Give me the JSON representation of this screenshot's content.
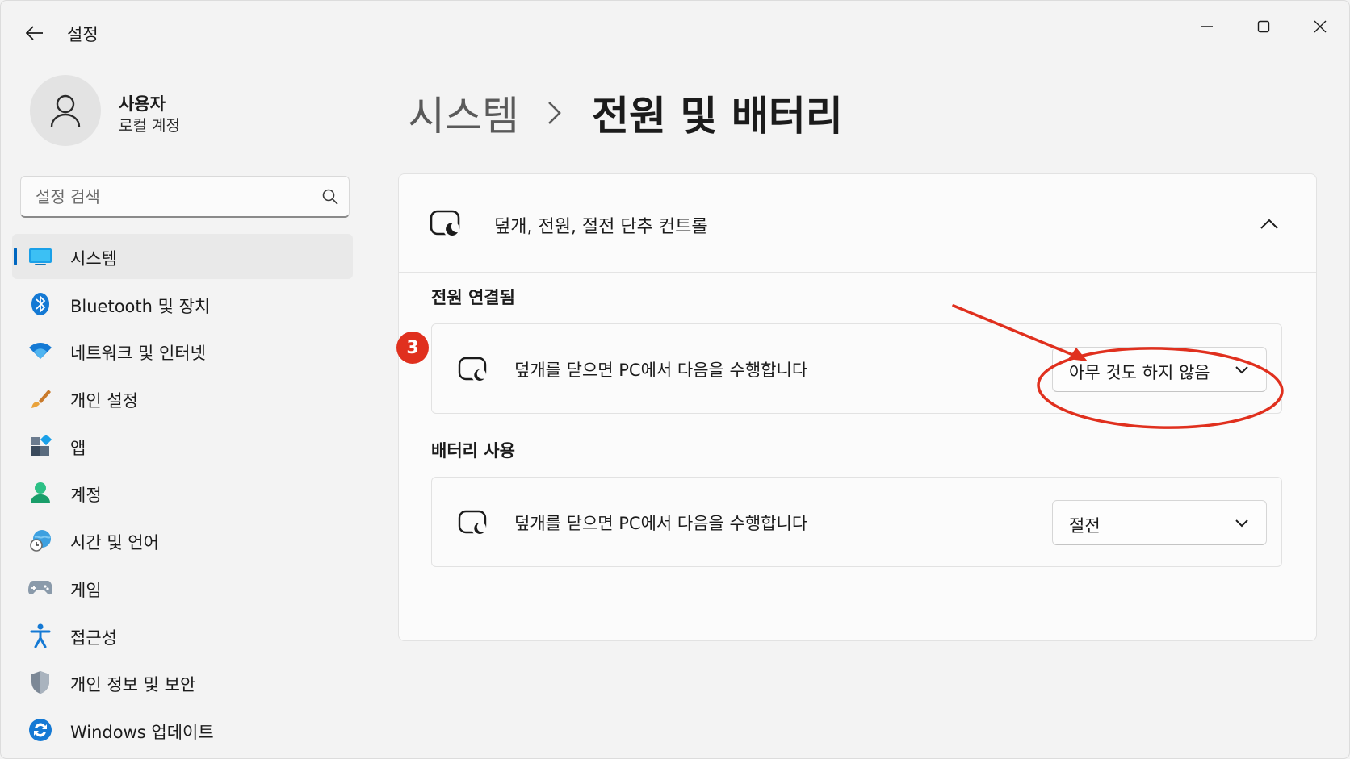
{
  "app": {
    "title": "설정"
  },
  "user": {
    "name": "사용자",
    "account_type": "로컬 계정"
  },
  "search": {
    "placeholder": "설정 검색"
  },
  "sidebar": {
    "items": [
      {
        "label": "시스템",
        "icon": "system-icon",
        "active": true
      },
      {
        "label": "Bluetooth 및 장치",
        "icon": "bluetooth-icon"
      },
      {
        "label": "네트워크 및 인터넷",
        "icon": "wifi-icon"
      },
      {
        "label": "개인 설정",
        "icon": "paint-brush-icon"
      },
      {
        "label": "앱",
        "icon": "apps-icon"
      },
      {
        "label": "계정",
        "icon": "account-icon"
      },
      {
        "label": "시간 및 언어",
        "icon": "time-language-icon"
      },
      {
        "label": "게임",
        "icon": "gamepad-icon"
      },
      {
        "label": "접근성",
        "icon": "accessibility-icon"
      },
      {
        "label": "개인 정보 및 보안",
        "icon": "shield-icon"
      },
      {
        "label": "Windows 업데이트",
        "icon": "windows-update-icon"
      }
    ]
  },
  "breadcrumb": {
    "parent": "시스템",
    "current": "전원 및 배터리"
  },
  "panel": {
    "title": "덮개, 전원, 절전 단추 컨트롤",
    "sections": [
      {
        "label": "전원 연결됨",
        "row_label": "덮개를 닫으면 PC에서 다음을 수행합니다",
        "value": "아무 것도 하지 않음"
      },
      {
        "label": "배터리 사용",
        "row_label": "덮개를 닫으면 PC에서 다음을 수행합니다",
        "value": "절전"
      }
    ]
  },
  "annotation": {
    "step": "3",
    "color": "#e0301e"
  },
  "colors": {
    "accent": "#0067c0",
    "background": "#f3f3f3"
  }
}
